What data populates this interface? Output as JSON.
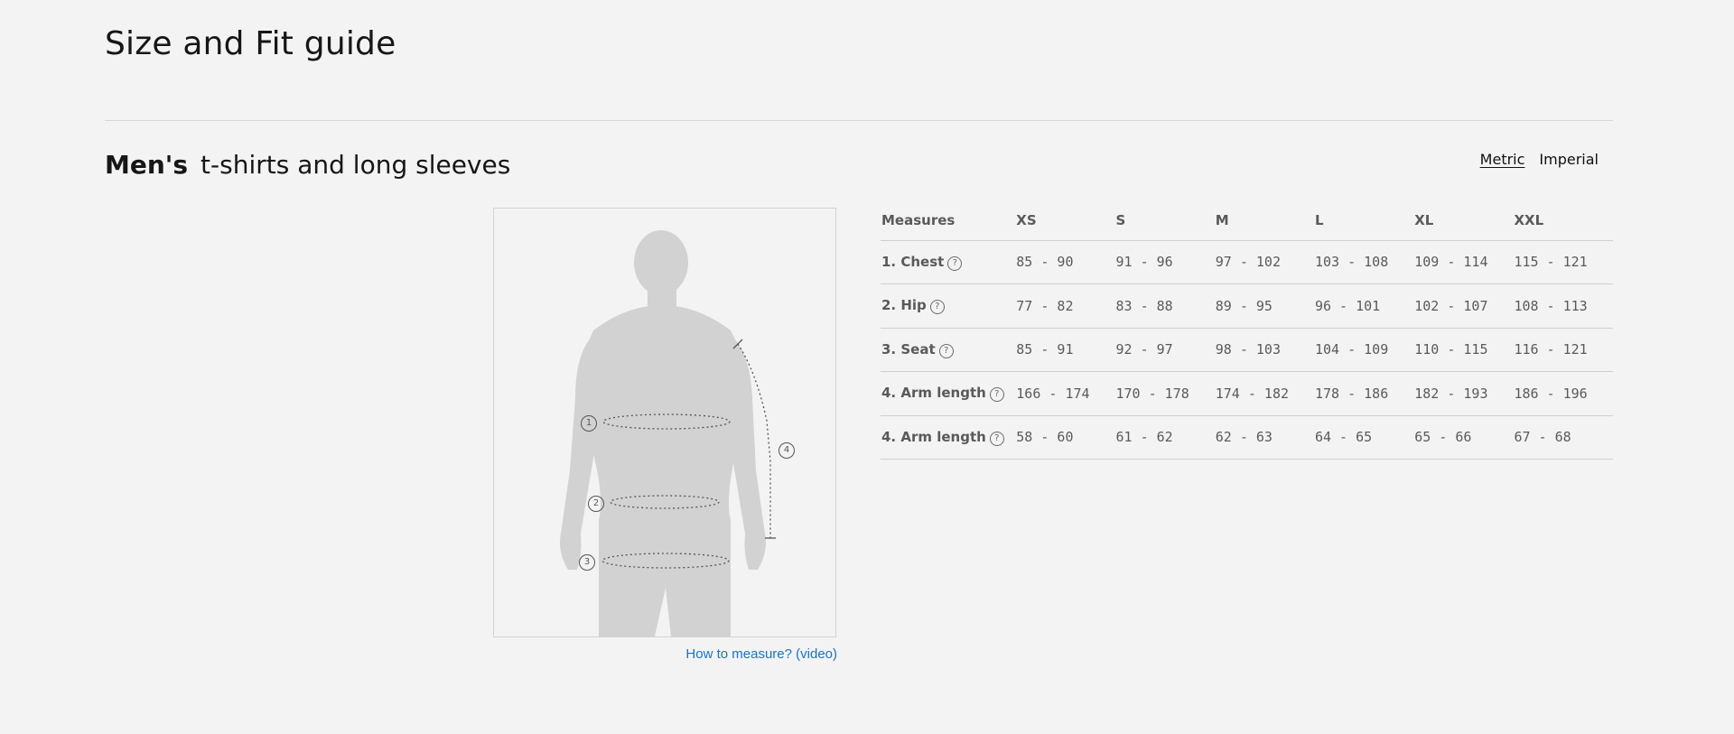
{
  "page": {
    "title": "Size and Fit guide"
  },
  "section": {
    "gender": "Men's",
    "category": "t-shirts and long sleeves"
  },
  "units": {
    "metric": "Metric",
    "imperial": "Imperial",
    "selected": "Metric"
  },
  "figure": {
    "markers": [
      "1",
      "2",
      "3",
      "4"
    ]
  },
  "video_link": "How to measure? (video)",
  "table": {
    "headers": [
      "Measures",
      "XS",
      "S",
      "M",
      "L",
      "XL",
      "XXL"
    ],
    "rows": [
      {
        "label": "1. Chest",
        "values": [
          "85 - 90",
          "91 - 96",
          "97 - 102",
          "103 - 108",
          "109 - 114",
          "115 - 121"
        ]
      },
      {
        "label": "2. Hip",
        "values": [
          "77 - 82",
          "83 - 88",
          "89 - 95",
          "96 - 101",
          "102 - 107",
          "108 - 113"
        ]
      },
      {
        "label": "3. Seat",
        "values": [
          "85 - 91",
          "92 - 97",
          "98 - 103",
          "104 - 109",
          "110 - 115",
          "116 - 121"
        ]
      },
      {
        "label": "4. Arm length",
        "values": [
          "166 - 174",
          "170 - 178",
          "174 - 182",
          "178 - 186",
          "182 - 193",
          "186 - 196"
        ]
      },
      {
        "label": "4. Arm length",
        "values": [
          "58 - 60",
          "61 - 62",
          "62 - 63",
          "64 - 65",
          "65 - 66",
          "67 - 68"
        ]
      }
    ],
    "help_icon": "?"
  }
}
